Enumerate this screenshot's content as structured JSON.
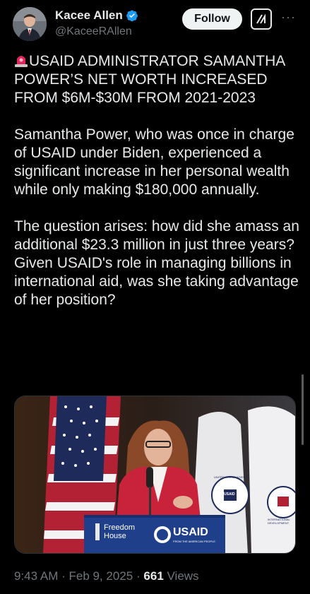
{
  "author": {
    "display_name": "Kacee Allen",
    "handle": "@KaceeRAllen",
    "verified": true
  },
  "actions": {
    "follow_label": "Follow",
    "grok_icon": "grok-icon",
    "more_icon": "more-options-icon"
  },
  "tweet": {
    "headline": "USAID ADMINISTRATOR SAMANTHA POWER’S NET WORTH INCREASED FROM $6M-$30M FROM 2021-2023",
    "paragraph_1": "Samantha Power, who was once in charge of USAID under Biden, experienced a significant increase in her personal wealth while only making $180,000 annually.",
    "paragraph_2": "The question arises: how did she amass an additional $23.3 million in just three years? Given USAID's role in managing billions in international aid, was she taking advantage of her position?"
  },
  "media": {
    "podium_left_label_1": "Freedom",
    "podium_left_label_2": "House",
    "podium_right_label": "USAID",
    "podium_right_sub": "FROM THE AMERICAN PEOPLE",
    "flag_text_1": "UNITED STATES AGENCY",
    "flag_text_2": "INTERNATIONAL DEVELOPMENT",
    "flag_center_label": "USAID"
  },
  "meta": {
    "time": "9:43 AM",
    "separator": "·",
    "date": "Feb 9, 2025",
    "views_count": "661",
    "views_label": "Views"
  },
  "colors": {
    "background": "#000000",
    "text": "#e7e9ea",
    "secondary": "#71767b",
    "verified": "#1d9bf0"
  }
}
